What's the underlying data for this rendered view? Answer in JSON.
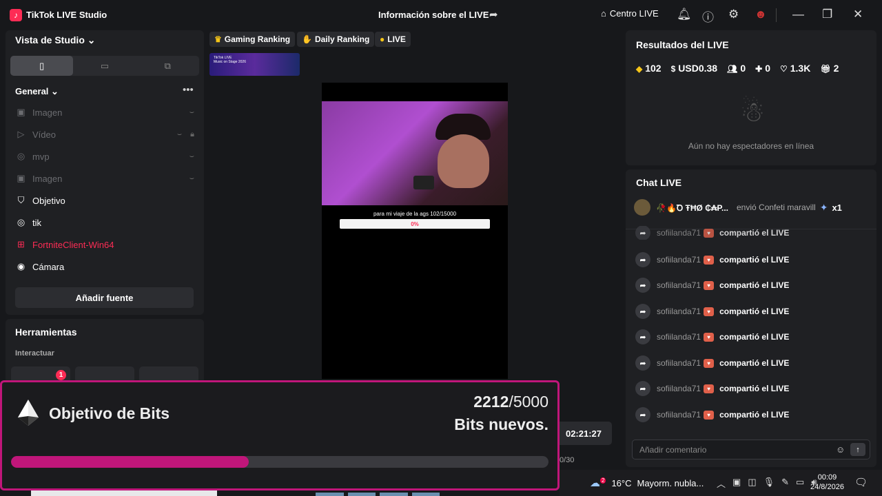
{
  "titlebar": {
    "app_name": "TikTok LIVE Studio",
    "live_info": "Información sobre el LIVE",
    "centro_live": "Centro LIVE"
  },
  "sidebar": {
    "vista": "Vista de Studio",
    "general": "General",
    "sources": [
      {
        "label": "Imagen",
        "icon": "image-icon",
        "enabled": false
      },
      {
        "label": "Vídeo",
        "icon": "video-icon",
        "enabled": false
      },
      {
        "label": "mvp",
        "icon": "globe-icon",
        "enabled": false
      },
      {
        "label": "Imagen",
        "icon": "image-icon",
        "enabled": false
      },
      {
        "label": "Objetivo",
        "icon": "goal-icon",
        "enabled": true
      },
      {
        "label": "tik",
        "icon": "globe-icon",
        "enabled": true
      },
      {
        "label": "FortniteClient-Win64",
        "icon": "game-capture-icon",
        "enabled": true,
        "color": "#fe2c55"
      },
      {
        "label": "Cámara",
        "icon": "camera-icon",
        "enabled": true
      }
    ],
    "add_source": "Añadir fuente",
    "tools_title": "Herramientas",
    "interact": "Interactuar",
    "badge": "1"
  },
  "tags": {
    "gaming": "Gaming Ranking",
    "daily": "Daily Ranking",
    "live": "LIVE"
  },
  "banner": {
    "line1": "TikTok LIVE",
    "line2": "Music on Stage 2026"
  },
  "preview": {
    "goal_text": "para mi viaje de la ags  102/15000",
    "goal_percent": "0%"
  },
  "timer": "02:21:27",
  "counter": "0/30",
  "results": {
    "title": "Resultados del LIVE",
    "diamonds": "102",
    "usd": "USD0.38",
    "viewers": "0",
    "followers": "0",
    "likes": "1.3K",
    "gifts": "2",
    "no_viewers": "Aún no hay espectadores en línea"
  },
  "chat": {
    "title": "Chat LIVE",
    "gift": {
      "user": "🥀🔥Ꝺ ŦĦØ ₵₳P...",
      "message": "envió Confeti maravill",
      "count": "x1"
    },
    "rows": [
      {
        "user": "sofiilanda71",
        "action": "compartió el LIVE"
      },
      {
        "user": "sofiilanda71",
        "action": "compartió el LIVE"
      },
      {
        "user": "sofiilanda71",
        "action": "compartió el LIVE"
      },
      {
        "user": "sofiilanda71",
        "action": "compartió el LIVE"
      },
      {
        "user": "sofiilanda71",
        "action": "compartió el LIVE"
      },
      {
        "user": "sofiilanda71",
        "action": "compartió el LIVE"
      },
      {
        "user": "sofiilanda71",
        "action": "compartió el LIVE"
      },
      {
        "user": "sofiilanda71",
        "action": "compartió el LIVE"
      }
    ],
    "placeholder": "Añadir comentario"
  },
  "bits": {
    "title": "Objetivo de Bits",
    "current": "2212",
    "total": "/5000",
    "subtitle": "Bits nuevos.",
    "progress": 0.4424,
    "color": "#c0167a"
  },
  "taskbar": {
    "temp": "16°C",
    "weather": "Mayorm. nubla...",
    "time": "00:09",
    "date": "24/8/2026",
    "weather_badge": "2"
  }
}
